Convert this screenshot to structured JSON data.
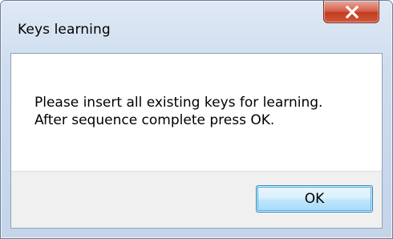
{
  "window": {
    "title": "Keys learning",
    "close_icon": "close-icon"
  },
  "message": {
    "line1": "Please insert all existing keys for learning.",
    "line2": "After sequence complete press OK."
  },
  "buttons": {
    "ok_label": "OK"
  },
  "colors": {
    "close_button": "#c43c1f",
    "ok_button_border": "#3c7fb1",
    "footer_bg": "#f0f0f0"
  }
}
